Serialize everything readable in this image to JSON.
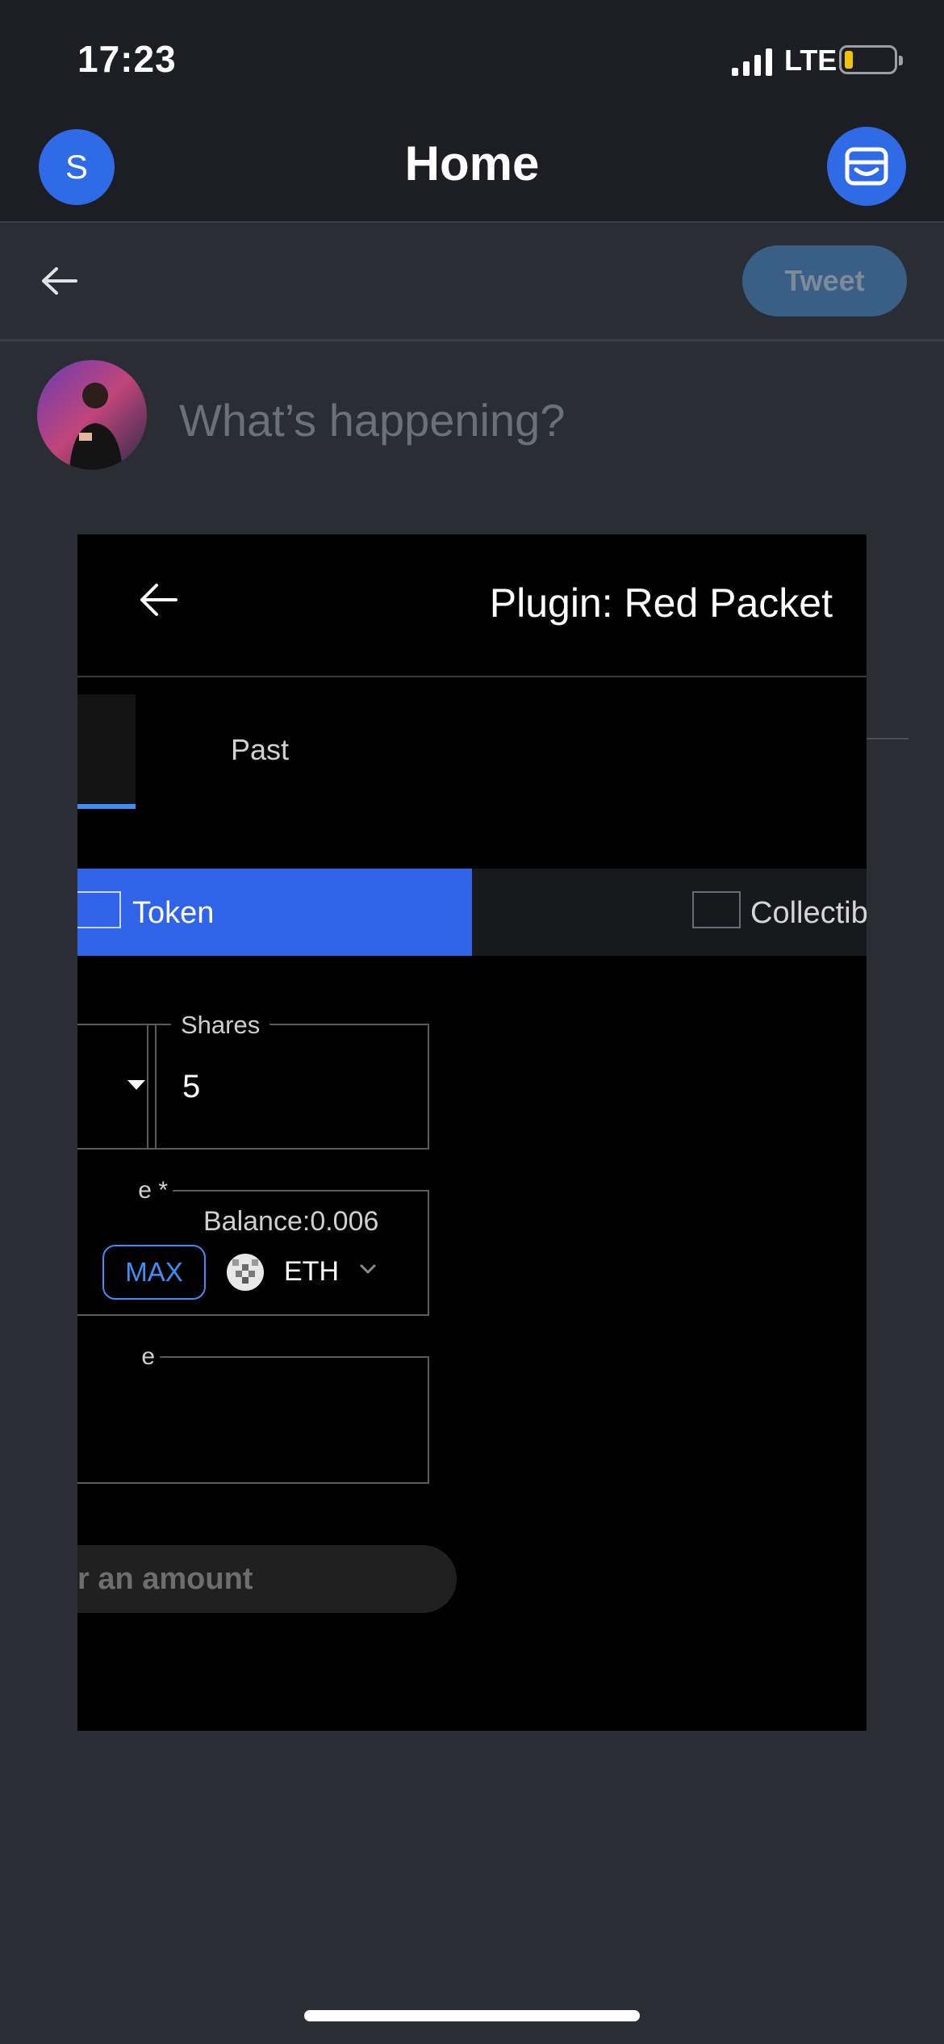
{
  "status_bar": {
    "time": "17:23",
    "network": "LTE"
  },
  "nav": {
    "avatar_letter": "S",
    "title": "Home"
  },
  "compose": {
    "tweet_label": "Tweet",
    "placeholder": "What’s happening?"
  },
  "modal": {
    "title": "Plugin: Red Packet",
    "tabs": [
      {
        "label": ""
      },
      {
        "label": "Past"
      }
    ],
    "type_options": [
      {
        "label": "Token",
        "selected": true
      },
      {
        "label": "Collectib",
        "selected": false
      }
    ],
    "fields": {
      "shares_label": "Shares",
      "shares_value": "5",
      "amount_label_fragment": "e *",
      "balance": "Balance:0.006",
      "max_label": "MAX",
      "token_symbol": "ETH",
      "message_label_fragment": "e"
    },
    "submit_label_fragment": "r an amount"
  },
  "colors": {
    "accent": "#3064e8",
    "link_blue": "#3d8ef7",
    "tweet_button": "#3a5f86",
    "background": "#2a2d33",
    "modal_bg": "#000000"
  }
}
